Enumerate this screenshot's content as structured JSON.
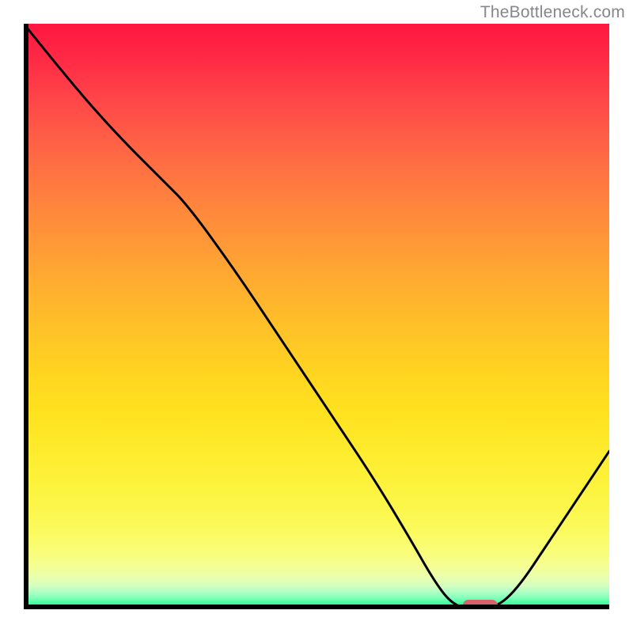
{
  "watermark": "TheBottleneck.com",
  "chart_data": {
    "type": "line",
    "title": "",
    "xlabel": "",
    "ylabel": "",
    "xlim": [
      0,
      100
    ],
    "ylim": [
      0,
      100
    ],
    "grid": false,
    "legend": false,
    "series": [
      {
        "name": "bottleneck-curve",
        "x": [
          0,
          8,
          16,
          24,
          28,
          36,
          44,
          52,
          60,
          66,
          70,
          73,
          76,
          80,
          84,
          90,
          96,
          100
        ],
        "y": [
          100,
          90,
          81,
          73,
          69,
          58,
          46,
          34,
          22,
          12,
          5,
          1,
          0,
          0,
          3,
          12,
          21,
          27
        ]
      }
    ],
    "marker": {
      "x": 78,
      "y": 0,
      "color": "#d7626c"
    },
    "gradient_stops": [
      {
        "pos": 0.0,
        "color": "#ff173f"
      },
      {
        "pos": 0.5,
        "color": "#ffb72c"
      },
      {
        "pos": 0.9,
        "color": "#fafd76"
      },
      {
        "pos": 1.0,
        "color": "#00ff7a"
      }
    ]
  }
}
